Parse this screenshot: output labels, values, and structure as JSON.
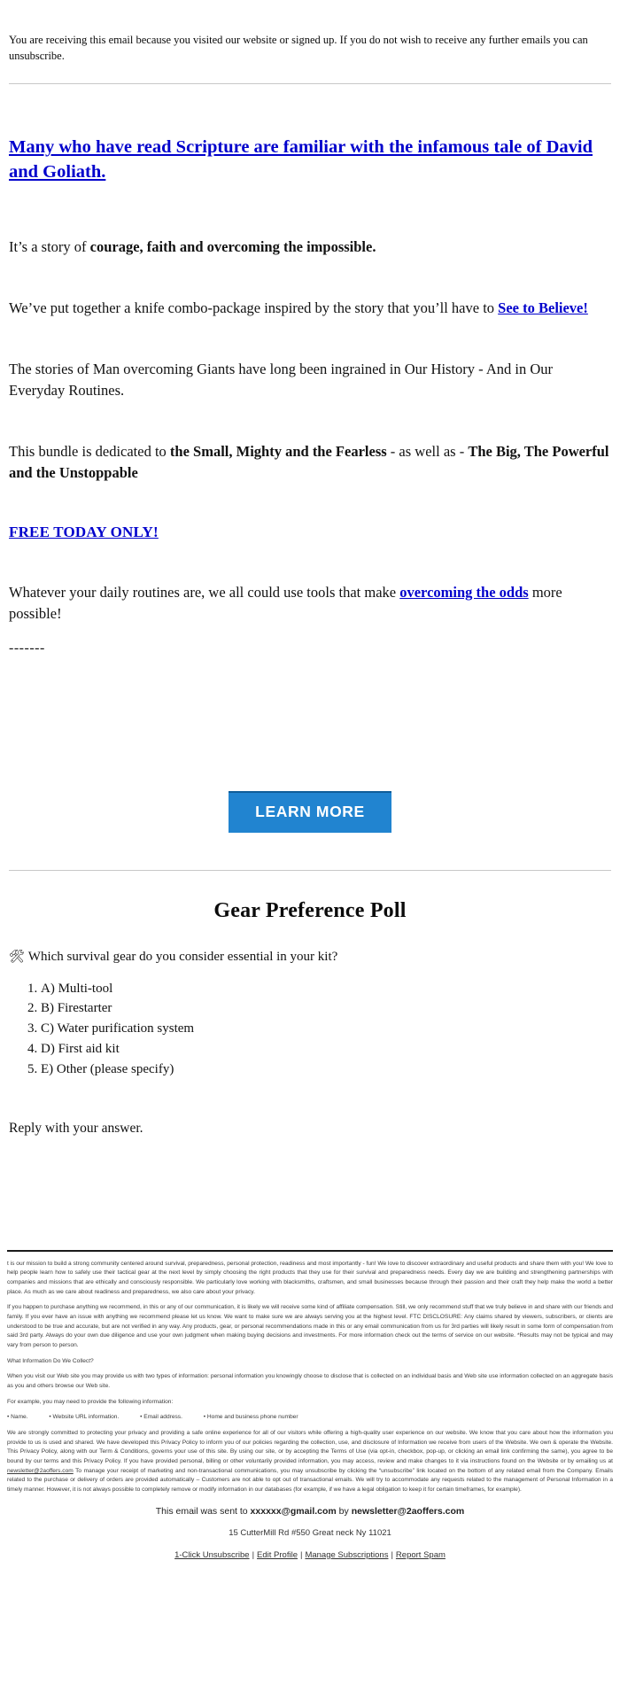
{
  "preheader": {
    "text": "You are receiving this email because you visited our website or signed up. If you do not wish to receive any further emails you can unsubscribe."
  },
  "body": {
    "headline": "Many who have read Scripture are familiar with the infamous tale of David and Goliath. ",
    "line_story_prefix": "It’s a story of ",
    "line_story_bold": "courage, faith and overcoming the impossible.",
    "line_knife": "We’ve put together a knife combo-package inspired by the story that you’ll have to ",
    "see_to_believe_link": "See to Believe! ",
    "line_giants": "The stories of Man overcoming Giants have long been ingrained in Our History - And in Our Everyday Routines.",
    "bundle_prefix": "This bundle is dedicated to ",
    "bundle_bold_1": "the Small, Mighty and the Fearless",
    "bundle_middle": " - as well as - ",
    "bundle_bold_2": "The Big, The Powerful and the Unstoppable",
    "free_today_link": "FREE TODAY ONLY!",
    "routines_prefix": "Whatever your daily routines are, we all could use tools that make ",
    "routines_link": "overcoming the odds",
    "routines_suffix": " more possible!",
    "dashes": "-------"
  },
  "cta": {
    "label": "LEARN MORE",
    "bg_color": "#2184d0",
    "text_color": "#ffffff"
  },
  "poll": {
    "title": "Gear Preference Poll",
    "icon": "🛠",
    "question": "Which survival gear do you consider essential in your kit?",
    "options": [
      "A) Multi-tool",
      "B) Firestarter",
      "C) Water purification system",
      "D) First aid kit",
      "E) Other (please specify)"
    ],
    "reply_prompt": "Reply with your answer."
  },
  "legal": {
    "paragraph_1": "t is our mission to build a strong community centered around survival, preparedness, personal protection, readiness and most importantly - fun! We love to discover extraordinary and useful products and share them with you! We love to help people learn how to safely use their tactical gear at the next level by simply choosing the right products that they use for their survival and preparedness needs. Every day we are building and strengthening partnerships with companies and missions that are ethically and consciously responsible. We particularly love working with blacksmiths, craftsmen, and small businesses because through their passion and their craft they help make the world a better place. As much as we care about readiness and preparedness, we also care about your privacy.",
    "paragraph_2": "If you happen to purchase anything we recommend, in this or any of our communication, it is likely we will receive some kind of affiliate compensation. Still, we only recommend stuff that we truly believe in and share with our friends and family. If you ever have an issue with anything we recommend please let us know. We want to make sure we are always serving you at the highest level. FTC DISCLOSURE: Any claims shared by viewers, subscribers, or clients are understood to be true and accurate, but are not verified in any way. Any products, gear, or personal recommendations made in this or any email communication from us for 3rd parties will likely result in some form of compensation from said 3rd party. Always do your own due diligence and use your own judgment when making buying decisions and investments. For more information check out the terms of service on our website. *Results may not be typical and may vary from person to person.",
    "heading_collect": "What Information Do We Collect?",
    "paragraph_3": "When you visit our Web site you may provide us with two types of information: personal information you knowingly choose to disclose that is collected on an individual basis and Web site use information collected on an aggregate basis as you and others browse our Web site.",
    "paragraph_4": "For example, you may need to provide the following information:",
    "bullets": [
      "• Name.",
      "• Website URL information.",
      "• Email address.",
      "• Home and business phone number"
    ],
    "paragraph_5_part1": "We are strongly committed to protecting your privacy and providing a safe online experience for all of our visitors while offering a high-quality user experience on our website. We know that you care about how the information you provide to us is used and shared. We have developed this Privacy Policy to inform you of our policies regarding the collection, use, and disclosure of Information we receive from users of the Website. We own & operate the Website. This Privacy Policy, along with our Term & Conditions, governs your use of this site. By using our site, or by accepting the Terms of Use (via opt-in, checkbox, pop-up, or clicking an email link confirming the same), you agree to be bound by our terms and this Privacy Policy. If you have provided personal, billing or other voluntarily provided information, you may access, review and make changes to it via instructions found on the Website or by emailing us at ",
    "paragraph_5_email": "newsletter@2aoffers.com",
    "paragraph_5_part2": " To manage your receipt of marketing and non-transactional communications, you may unsubscribe by clicking the “unsubscribe” link located on the bottom of any related email from the Company. Emails related to the purchase or delivery of orders are provided automatically – Customers are not able to opt out of transactional emails. We will try to accommodate any requests related to the management of Personal Information in a timely manner. However, it is not always possible to completely remove or modify information in our databases (for example, if we have a legal obligation to keep it for certain timeframes, for example)."
  },
  "footer": {
    "sent_prefix": "This email was sent to ",
    "sent_recipient": "xxxxxx@gmail.com",
    "sent_by": " by ",
    "sent_sender": "newsletter@2aoffers.com",
    "address": "15 CutterMill Rd #550 Great neck Ny 11021",
    "links": [
      "1-Click Unsubscribe",
      "Edit Profile",
      "Manage Subscriptions",
      "Report Spam"
    ],
    "separator": "|"
  }
}
